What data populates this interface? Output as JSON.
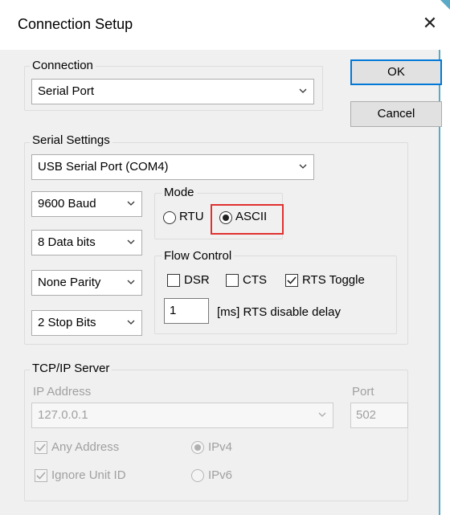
{
  "window": {
    "title": "Connection Setup"
  },
  "buttons": {
    "ok": "OK",
    "cancel": "Cancel"
  },
  "connection": {
    "group_label": "Connection",
    "selected": "Serial Port"
  },
  "serial_settings": {
    "group_label": "Serial Settings",
    "port": "USB Serial Port (COM4)",
    "baud": "9600 Baud",
    "data_bits": "8 Data bits",
    "parity": "None Parity",
    "stop_bits": "2 Stop Bits",
    "mode": {
      "group_label": "Mode",
      "options": [
        "RTU",
        "ASCII"
      ],
      "selected": "ASCII"
    },
    "flow_control": {
      "group_label": "Flow Control",
      "dsr": {
        "label": "DSR",
        "checked": false
      },
      "cts": {
        "label": "CTS",
        "checked": false
      },
      "rts_toggle": {
        "label": "RTS Toggle",
        "checked": true
      },
      "rts_delay_value": "1",
      "rts_delay_label": "[ms] RTS disable delay"
    }
  },
  "tcp_ip": {
    "group_label": "TCP/IP Server",
    "ip_label": "IP Address",
    "ip_value": "127.0.0.1",
    "port_label": "Port",
    "port_value": "502",
    "any_address": {
      "label": "Any Address",
      "checked": true
    },
    "ignore_unit_id": {
      "label": "Ignore Unit ID",
      "checked": true
    },
    "ip_versions": [
      "IPv4",
      "IPv6"
    ],
    "ip_version_selected": "IPv4"
  },
  "icons": {
    "close": "close-icon",
    "chevron": "chevron-down-icon",
    "check": "checkmark-icon"
  },
  "colors": {
    "highlight": "#e03030",
    "default_button_border": "#0078d7",
    "window_accent": "#5aa9c6"
  }
}
